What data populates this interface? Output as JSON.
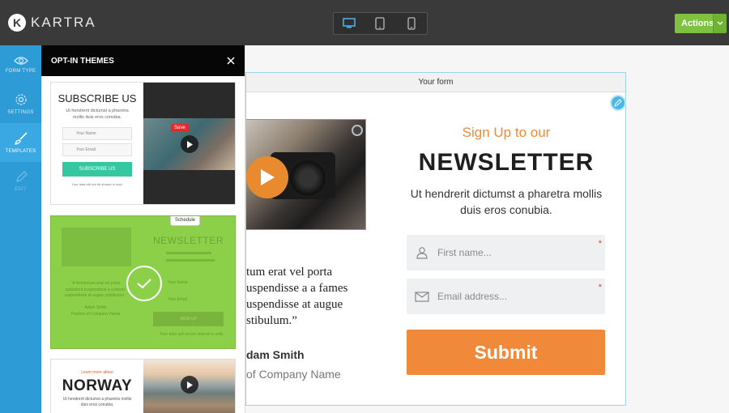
{
  "topbar": {
    "brand": "KARTRA",
    "actions_label": "Actions"
  },
  "devices": [
    "desktop-icon",
    "tablet-icon",
    "mobile-icon"
  ],
  "rail": {
    "items": [
      {
        "label": "FORM TYPE",
        "icon": "eye-icon"
      },
      {
        "label": "SETTINGS",
        "icon": "gear-icon"
      },
      {
        "label": "TEMPLATES",
        "icon": "brush-icon"
      },
      {
        "label": "EDIT",
        "icon": "pencil-icon"
      }
    ]
  },
  "panel": {
    "title": "OPT-IN THEMES",
    "theme1": {
      "title": "SUBSCRIBE US",
      "subtitle": "Ut hendrerit dictumst a pharetra mollis duis eros conubia.",
      "name_placeholder": "Your Name",
      "email_placeholder": "Your Email",
      "button": "SUBSCRIBE US",
      "footer": "Your data will not be shared or sold.",
      "save_badge": "Save"
    },
    "theme2": {
      "schedule_label": "Schedule",
      "title": "NEWSLETTER",
      "quote": "\"A fermentum erat vel porta parturient suspendisse a a fames suspendisse at augue vestibulum.\"",
      "name_label": "Your Name",
      "email_label": "Your Email",
      "button": "SIGN UP",
      "author": "Adam Smith",
      "author_title": "Position of Company Name",
      "footer": "Your data will not be shared or sold."
    },
    "theme3": {
      "learn_more": "Learn more about",
      "title": "NORWAY",
      "subtitle": "Ut hendrerit dictumst a pharetra mollis duis eros conubia."
    }
  },
  "form": {
    "header": "Your form",
    "quote": "tum erat vel porta\nuspendisse a a fames\nuspendisse at augue\nstibulum.”",
    "author": "dam Smith",
    "company": "of Company Name",
    "signup": "Sign Up to our",
    "newsletter": "NEWSLETTER",
    "description": "Ut hendrerit dictumst a pharetra mollis duis eros conubia.",
    "first_name_placeholder": "First name...",
    "email_placeholder": "Email address...",
    "required_mark": "*",
    "submit": "Submit"
  },
  "colors": {
    "topbar": "#3a3a3a",
    "rail": "#2d9bd6",
    "accent_green": "#7fc241",
    "theme_green": "#8cd04a",
    "orange": "#f08a3a",
    "teal_button": "#35c7a0"
  }
}
